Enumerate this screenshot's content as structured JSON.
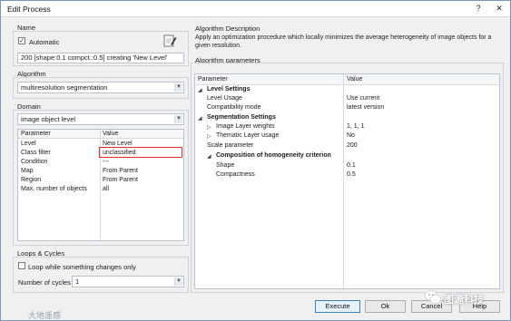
{
  "window": {
    "title": "Edit Process",
    "help_btn": "?",
    "close_btn": "✕"
  },
  "name_group": {
    "label": "Name",
    "automatic_label": "Automatic",
    "automatic_checked": true,
    "name_value": "200 [shape:0.1 compct.:0.5] creating 'New Level'"
  },
  "algorithm_group": {
    "label": "Algorithm",
    "value": "multiresolution segmentation"
  },
  "domain_group": {
    "label": "Domain",
    "value": "image object level",
    "headers": {
      "param": "Parameter",
      "value": "Value"
    },
    "rows": [
      {
        "param": "Level",
        "value": "New Level"
      },
      {
        "param": "Class filter",
        "value": "unclassified"
      },
      {
        "param": "Condition",
        "value": "---"
      },
      {
        "param": "Map",
        "value": "From Parent"
      },
      {
        "param": "Region",
        "value": "From Parent"
      },
      {
        "param": "Max. number of objects",
        "value": "all"
      }
    ]
  },
  "loops_group": {
    "label": "Loops & Cycles",
    "loop_label": "Loop while something changes only",
    "loop_checked": false,
    "cycles_label": "Number of cycles",
    "cycles_value": "1"
  },
  "algo_desc": {
    "label": "Algorithm Description",
    "text": "Apply an optimization procedure which locally minimizes the average heterogeneity of image objects for a given resolution."
  },
  "algo_params": {
    "label": "Algorithm parameters",
    "headers": {
      "param": "Parameter",
      "value": "Value"
    },
    "level_settings": "Level Settings",
    "level_usage": {
      "param": "Level Usage",
      "value": "Use current"
    },
    "compat_mode": {
      "param": "Compatibility mode",
      "value": "latest version"
    },
    "seg_settings": "Segmentation Settings",
    "img_layer_weights": {
      "param": "Image Layer weights",
      "value": "1, 1, 1"
    },
    "thematic_usage": {
      "param": "Thematic Layer usage",
      "value": "No"
    },
    "scale_param": {
      "param": "Scale parameter",
      "value": "200"
    },
    "composition": "Composition of homogeneity criterion",
    "shape": {
      "param": "Shape",
      "value": "0.1"
    },
    "compactness": {
      "param": "Compactness",
      "value": "0.5"
    }
  },
  "buttons": {
    "execute": "Execute",
    "ok": "Ok",
    "cancel": "Cancel",
    "help": "Help"
  },
  "watermarks": {
    "left": "大地遥感",
    "right": "图源科技"
  },
  "colors": {
    "highlight": "#e0322a",
    "accent": "#3c7fb1"
  }
}
